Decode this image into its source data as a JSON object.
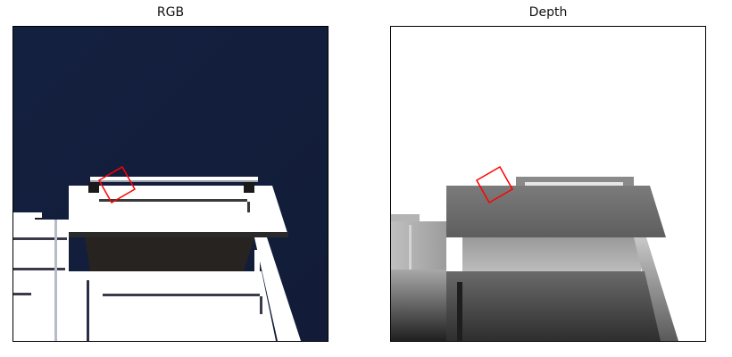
{
  "panels": [
    {
      "title": "RGB"
    },
    {
      "title": "Depth"
    }
  ],
  "colors": {
    "sky": "#142040",
    "object_white": "#ffffff",
    "shadow_dark": "#272320",
    "grasp_box": "#ff0000"
  },
  "icons": [
    "grasp-rectangle"
  ]
}
